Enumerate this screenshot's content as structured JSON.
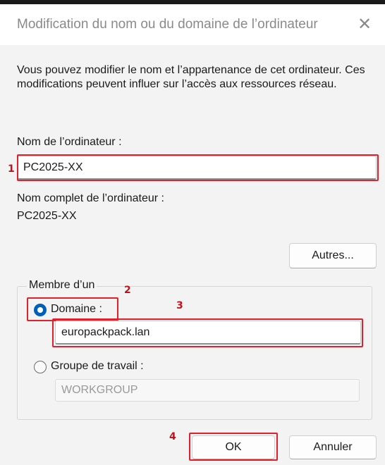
{
  "window": {
    "title": "Modification du nom ou du domaine de l’ordinateur",
    "close_glyph": "✕"
  },
  "description": "Vous pouvez modifier le nom et l’appartenance de cet ordinateur. Ces modifications peuvent influer sur l’accès aux ressources réseau.",
  "computer_name": {
    "label": "Nom de l’ordinateur :",
    "value": "PC2025-XX"
  },
  "full_name": {
    "label": "Nom complet de l’ordinateur :",
    "value": "PC2025-XX"
  },
  "more_button": "Autres...",
  "member_of": {
    "legend": "Membre d’un",
    "domain_label": "Domaine :",
    "domain_value": "europackpack.lan",
    "domain_selected": true,
    "workgroup_label": "Groupe de travail :",
    "workgroup_value": "WORKGROUP",
    "workgroup_selected": false
  },
  "buttons": {
    "ok": "OK",
    "cancel": "Annuler"
  },
  "annotations": {
    "marker_1": "1",
    "marker_2": "2",
    "marker_3": "3",
    "marker_4": "4",
    "highlight_color": "#e0202a"
  },
  "colors": {
    "accent": "#005fb8",
    "dialog_bg": "#f3f3f3"
  },
  "icons": {
    "close": "close-icon",
    "radio_selected": "radio-selected-icon",
    "radio_unselected": "radio-unselected-icon"
  }
}
